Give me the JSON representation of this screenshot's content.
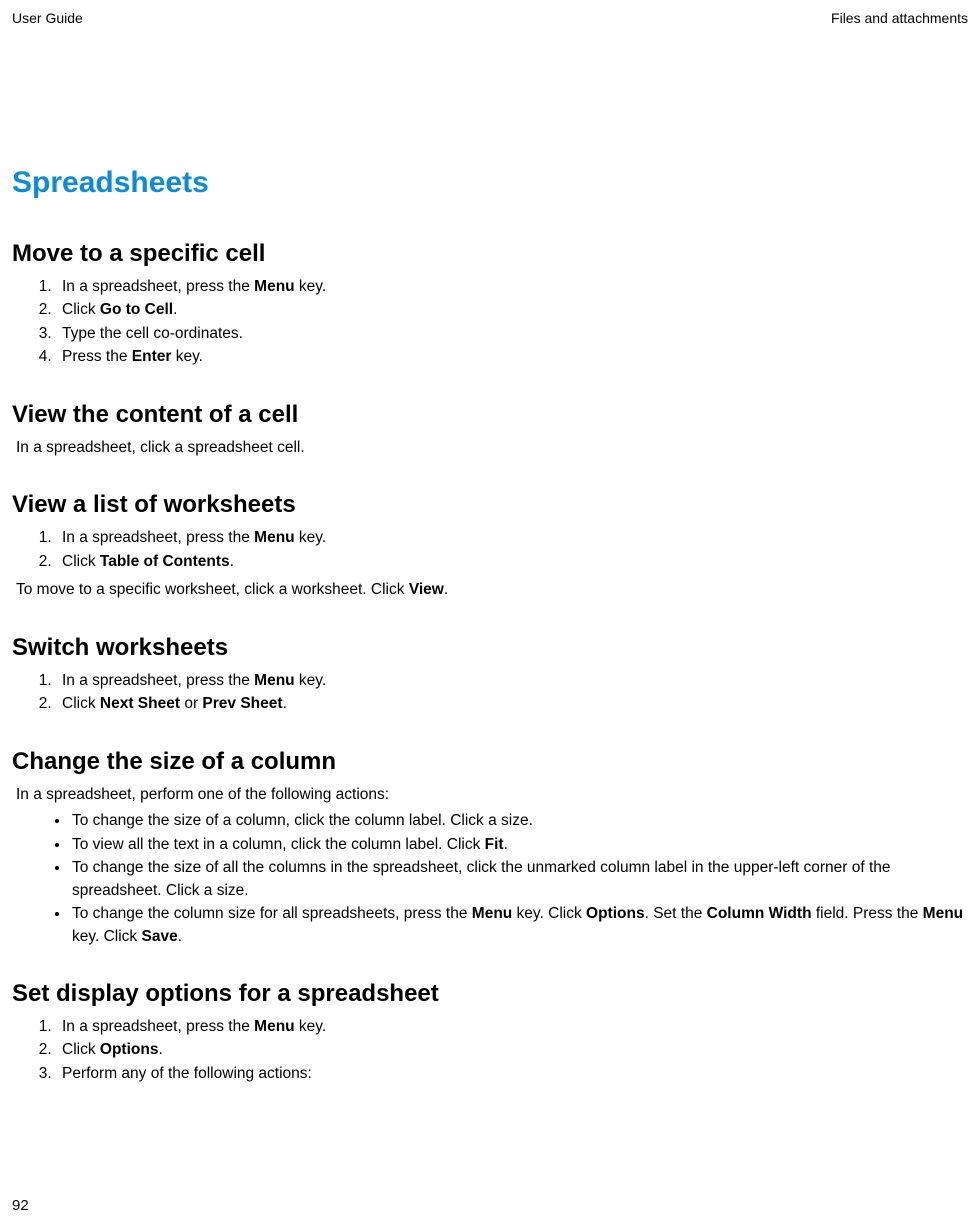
{
  "header": {
    "left": "User Guide",
    "right": "Files and attachments"
  },
  "page_number": "92",
  "title": "Spreadsheets",
  "sections": [
    {
      "heading": "Move to a specific cell",
      "ordered": [
        [
          {
            "t": "In a spreadsheet, press the "
          },
          {
            "t": "Menu",
            "b": true
          },
          {
            "t": " key."
          }
        ],
        [
          {
            "t": "Click "
          },
          {
            "t": "Go to Cell",
            "b": true
          },
          {
            "t": "."
          }
        ],
        [
          {
            "t": "Type the cell co-ordinates."
          }
        ],
        [
          {
            "t": "Press the "
          },
          {
            "t": "Enter",
            "b": true
          },
          {
            "t": " key."
          }
        ]
      ]
    },
    {
      "heading": "View the content of a cell",
      "para": [
        {
          "t": "In a spreadsheet, click a spreadsheet cell."
        }
      ]
    },
    {
      "heading": "View a list of worksheets",
      "ordered": [
        [
          {
            "t": "In a spreadsheet, press the "
          },
          {
            "t": "Menu",
            "b": true
          },
          {
            "t": " key."
          }
        ],
        [
          {
            "t": "Click "
          },
          {
            "t": "Table of Contents",
            "b": true
          },
          {
            "t": "."
          }
        ]
      ],
      "after_para": [
        {
          "t": "To move to a specific worksheet, click a worksheet. Click "
        },
        {
          "t": "View",
          "b": true
        },
        {
          "t": "."
        }
      ]
    },
    {
      "heading": "Switch worksheets",
      "ordered": [
        [
          {
            "t": "In a spreadsheet, press the "
          },
          {
            "t": "Menu",
            "b": true
          },
          {
            "t": " key."
          }
        ],
        [
          {
            "t": "Click "
          },
          {
            "t": "Next Sheet",
            "b": true
          },
          {
            "t": " or "
          },
          {
            "t": "Prev Sheet",
            "b": true
          },
          {
            "t": "."
          }
        ]
      ]
    },
    {
      "heading": "Change the size of a column",
      "para": [
        {
          "t": "In a spreadsheet, perform one of the following actions:"
        }
      ],
      "bulleted": [
        [
          {
            "t": "To change the size of a column, click the column label. Click a size."
          }
        ],
        [
          {
            "t": "To view all the text in a column, click the column label. Click "
          },
          {
            "t": "Fit",
            "b": true
          },
          {
            "t": "."
          }
        ],
        [
          {
            "t": "To change the size of all the columns in the spreadsheet, click the unmarked column label in the upper-left corner of the spreadsheet. Click a size."
          }
        ],
        [
          {
            "t": "To change the column size for all spreadsheets, press the "
          },
          {
            "t": "Menu",
            "b": true
          },
          {
            "t": " key. Click "
          },
          {
            "t": "Options",
            "b": true
          },
          {
            "t": ". Set the "
          },
          {
            "t": "Column Width",
            "b": true
          },
          {
            "t": " field. Press the "
          },
          {
            "t": "Menu",
            "b": true
          },
          {
            "t": " key. Click "
          },
          {
            "t": "Save",
            "b": true
          },
          {
            "t": "."
          }
        ]
      ]
    },
    {
      "heading": "Set display options for a spreadsheet",
      "ordered": [
        [
          {
            "t": "In a spreadsheet, press the "
          },
          {
            "t": "Menu",
            "b": true
          },
          {
            "t": " key."
          }
        ],
        [
          {
            "t": "Click "
          },
          {
            "t": "Options",
            "b": true
          },
          {
            "t": "."
          }
        ],
        [
          {
            "t": "Perform any of the following actions:"
          }
        ]
      ]
    }
  ]
}
